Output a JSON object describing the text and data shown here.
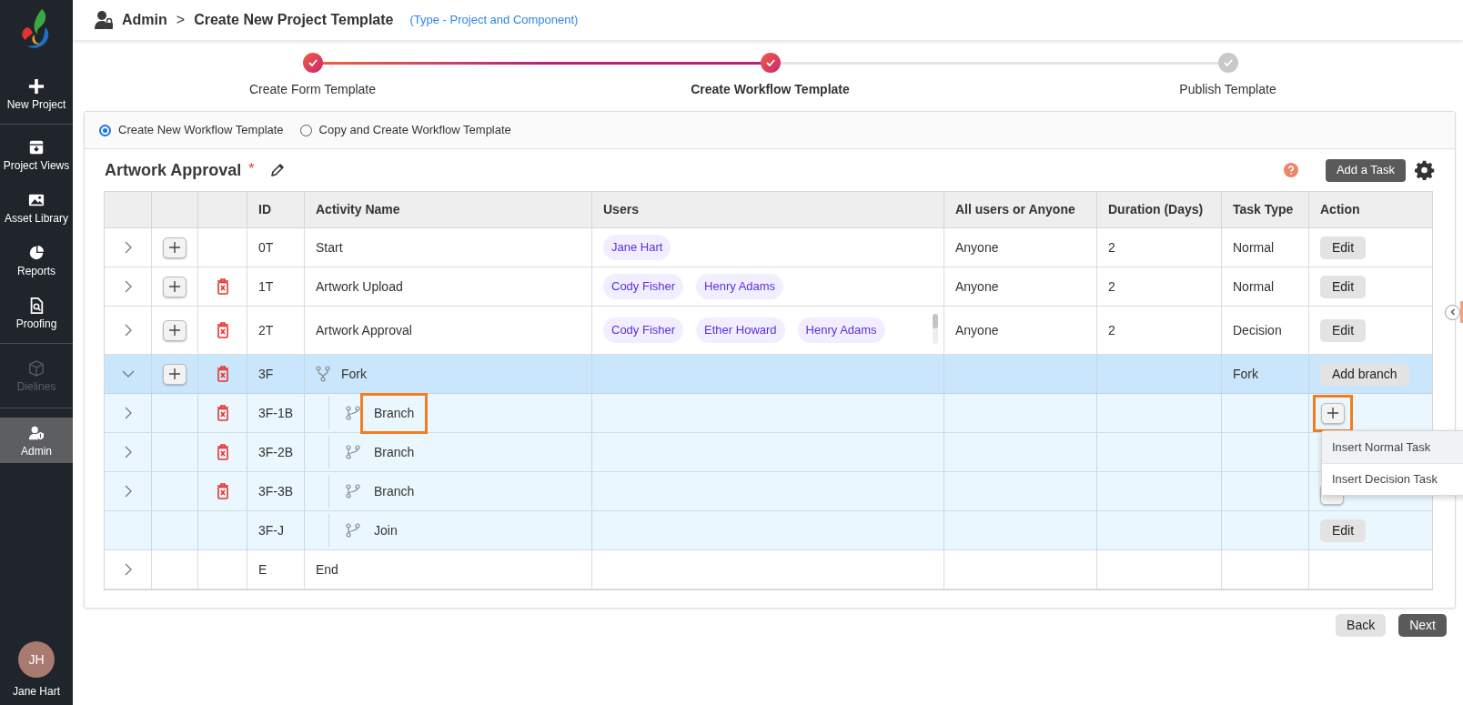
{
  "sidebar": {
    "items": [
      {
        "label": "New Project",
        "selected": false,
        "disabled": false
      },
      {
        "label": "Project Views",
        "selected": false,
        "disabled": false
      },
      {
        "label": "Asset Library",
        "selected": false,
        "disabled": false
      },
      {
        "label": "Reports",
        "selected": false,
        "disabled": false
      },
      {
        "label": "Proofing",
        "selected": false,
        "disabled": false
      },
      {
        "label": "Dielines",
        "selected": false,
        "disabled": true
      },
      {
        "label": "Admin",
        "selected": true,
        "disabled": false
      }
    ],
    "user": {
      "initials": "JH",
      "name": "Jane Hart"
    }
  },
  "header": {
    "breadcrumb": [
      "Admin",
      ">",
      "Create New Project Template"
    ],
    "type_note": "(Type - Project and Component)"
  },
  "stepper": [
    {
      "label": "Create Form Template",
      "completed": true,
      "selected": false
    },
    {
      "label": "Create Workflow Template",
      "completed": true,
      "selected": true
    },
    {
      "label": "Publish Template",
      "completed": false,
      "selected": false
    }
  ],
  "mode_options": [
    {
      "label": "Create New Workflow Template",
      "selected": true
    },
    {
      "label": "Copy and Create Workflow Template",
      "selected": false
    }
  ],
  "workflow": {
    "title": "Artwork Approval",
    "required_mark": "*",
    "add_task_button": "Add a Task"
  },
  "table": {
    "columns": [
      "",
      "",
      "",
      "ID",
      "Activity Name",
      "Users",
      "All users or Anyone",
      "Duration (Days)",
      "Task Type",
      "Action"
    ],
    "rows": [
      {
        "kind": "task",
        "expanded": false,
        "add": true,
        "delete": false,
        "id": "0T",
        "name": "Start",
        "users": [
          "Jane Hart"
        ],
        "assign": "Anyone",
        "duration": "2",
        "type": "Normal",
        "action": "Edit"
      },
      {
        "kind": "task",
        "expanded": false,
        "add": true,
        "delete": true,
        "id": "1T",
        "name": "Artwork Upload",
        "users": [
          "Cody Fisher",
          "Henry Adams"
        ],
        "assign": "Anyone",
        "duration": "2",
        "type": "Normal",
        "action": "Edit"
      },
      {
        "kind": "task",
        "expanded": false,
        "add": true,
        "delete": true,
        "id": "2T",
        "name": "Artwork Approval",
        "users": [
          "Cody Fisher",
          "Ether Howard",
          "Henry Adams"
        ],
        "assign": "Anyone",
        "duration": "2",
        "type": "Decision",
        "action": "Edit"
      },
      {
        "kind": "fork",
        "expanded": true,
        "add": true,
        "delete": true,
        "id": "3F",
        "name": "Fork",
        "type": "Fork",
        "action": "Add branch"
      },
      {
        "kind": "branch",
        "expanded": false,
        "add": false,
        "delete": true,
        "id": "3F-1B",
        "name": "Branch",
        "highlighted": true,
        "insert": true,
        "insert_highlighted": true
      },
      {
        "kind": "branch",
        "expanded": false,
        "add": false,
        "delete": true,
        "id": "3F-2B",
        "name": "Branch"
      },
      {
        "kind": "branch",
        "expanded": false,
        "add": false,
        "delete": true,
        "id": "3F-3B",
        "name": "Branch",
        "insert": true
      },
      {
        "kind": "join",
        "add": false,
        "delete": false,
        "id": "3F-J",
        "name": "Join",
        "action": "Edit"
      },
      {
        "kind": "task",
        "expanded": false,
        "add": false,
        "delete": false,
        "id": "E",
        "name": "End"
      }
    ]
  },
  "insert_menu": [
    {
      "label": "Insert Normal Task",
      "selected": true
    },
    {
      "label": "Insert Decision Task",
      "selected": false
    }
  ],
  "footer": {
    "back": "Back",
    "next": "Next"
  }
}
